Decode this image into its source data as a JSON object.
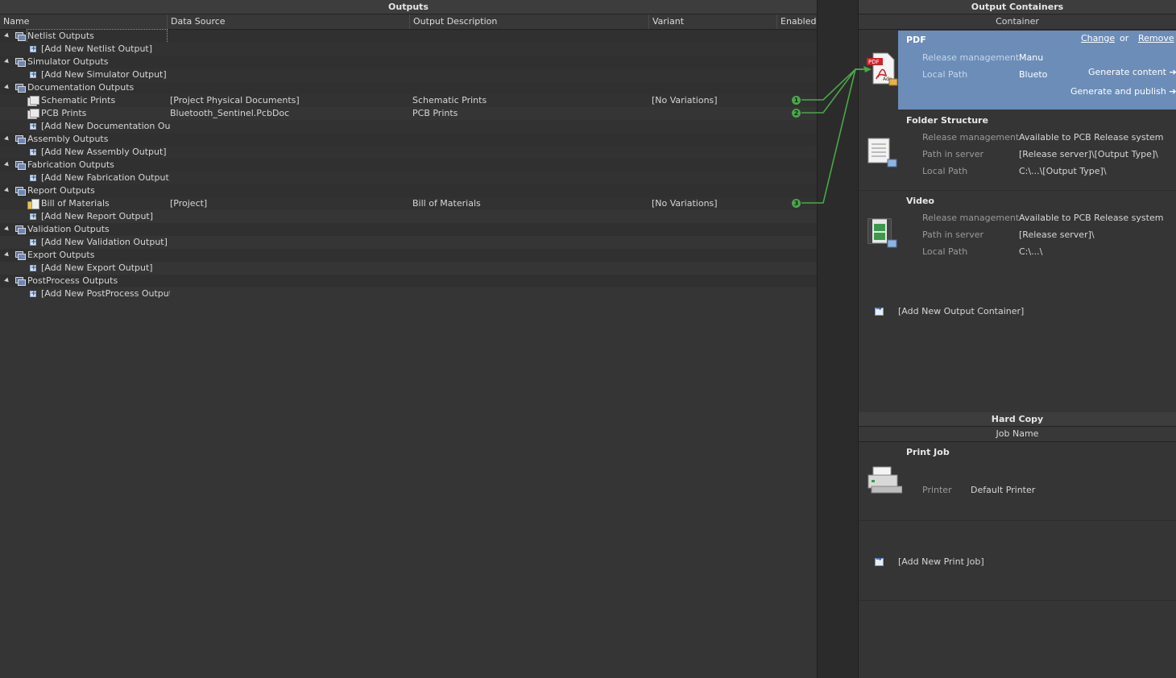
{
  "outputs": {
    "title": "Outputs",
    "columns": [
      "Name",
      "Data Source",
      "Output Description",
      "Variant",
      "Enabled"
    ],
    "rows": [
      {
        "type": "group",
        "name": "Netlist Outputs"
      },
      {
        "type": "add",
        "name": "[Add New Netlist Output]"
      },
      {
        "type": "group",
        "name": "Simulator Outputs"
      },
      {
        "type": "add",
        "name": "[Add New Simulator Output]"
      },
      {
        "type": "group",
        "name": "Documentation Outputs"
      },
      {
        "type": "item",
        "icon": "doc",
        "name": "Schematic Prints",
        "source": "[Project Physical Documents]",
        "desc": "Schematic Prints",
        "variant": "[No Variations]",
        "enabled": "1"
      },
      {
        "type": "item",
        "icon": "doc",
        "name": "PCB Prints",
        "source": "Bluetooth_Sentinel.PcbDoc",
        "desc": "PCB Prints",
        "variant": "",
        "enabled": "2"
      },
      {
        "type": "add",
        "name": "[Add New Documentation Out"
      },
      {
        "type": "group",
        "name": "Assembly Outputs"
      },
      {
        "type": "add",
        "name": "[Add New Assembly Output]"
      },
      {
        "type": "group",
        "name": "Fabrication Outputs"
      },
      {
        "type": "add",
        "name": "[Add New Fabrication Output]"
      },
      {
        "type": "group",
        "name": "Report Outputs"
      },
      {
        "type": "item",
        "icon": "bom",
        "name": "Bill of Materials",
        "source": "[Project]",
        "desc": "Bill of Materials",
        "variant": "[No Variations]",
        "enabled": "3"
      },
      {
        "type": "add",
        "name": "[Add New Report Output]"
      },
      {
        "type": "group",
        "name": "Validation Outputs"
      },
      {
        "type": "add",
        "name": "[Add New Validation Output]"
      },
      {
        "type": "group",
        "name": "Export Outputs"
      },
      {
        "type": "add",
        "name": "[Add New Export Output]"
      },
      {
        "type": "group",
        "name": "PostProcess Outputs"
      },
      {
        "type": "add",
        "name": "[Add New PostProcess Output]"
      }
    ]
  },
  "containers": {
    "title": "Output Containers",
    "subtitle": "Container",
    "pdf": {
      "title": "PDF",
      "change": "Change",
      "or": "or",
      "remove": "Remove",
      "release_label": "Release management",
      "release_value": "Manu",
      "local_label": "Local Path",
      "local_value": "Blueto",
      "generate_content": "Generate content ➔",
      "generate_publish": "Generate and publish ➔"
    },
    "folder": {
      "title": "Folder Structure",
      "release_label": "Release management",
      "release_value": "Available to PCB Release system",
      "server_label": "Path in server",
      "server_value": "[Release server]\\[Output Type]\\",
      "local_label": "Local Path",
      "local_value": "C:\\...\\[Output Type]\\"
    },
    "video": {
      "title": "Video",
      "release_label": "Release management",
      "release_value": "Available to PCB Release system",
      "server_label": "Path in server",
      "server_value": "[Release server]\\",
      "local_label": "Local Path",
      "local_value": "C:\\...\\"
    },
    "add_container": "[Add New Output Container]"
  },
  "hardcopy": {
    "title": "Hard Copy",
    "subtitle": "Job Name",
    "job": {
      "title": "Print Job",
      "printer_label": "Printer",
      "printer_value": "Default Printer"
    },
    "add_job": "[Add New Print Job]"
  },
  "colors": {
    "panel": "#353535",
    "selection": "#6b8db8",
    "link_line": "#4aa84a"
  }
}
